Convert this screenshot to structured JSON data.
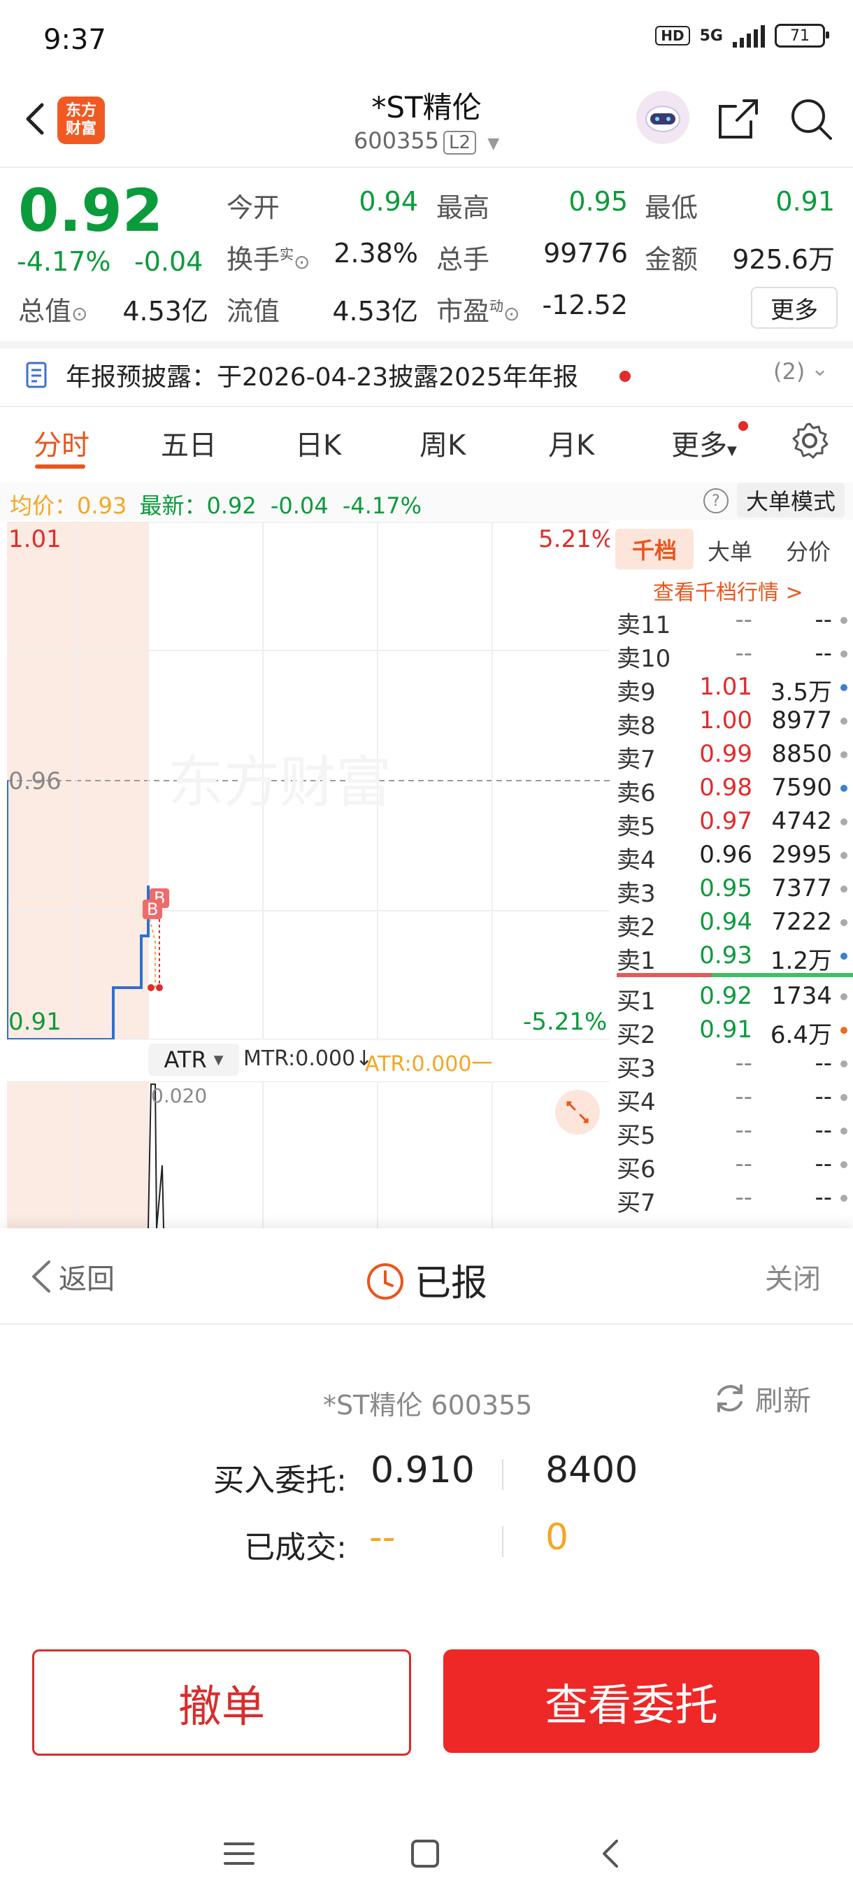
{
  "status_bar": {
    "time": "9:37",
    "hd": "HD",
    "network": "5G",
    "battery": "71"
  },
  "header": {
    "logo_line1": "东方",
    "logo_line2": "财富",
    "title": "*ST精伦",
    "code": "600355",
    "level": "L2"
  },
  "quote": {
    "price": "0.92",
    "pct": "-4.17%",
    "chg": "-0.04",
    "open_label": "今开",
    "open": "0.94",
    "high_label": "最高",
    "high": "0.95",
    "low_label": "最低",
    "low": "0.91",
    "turnover_label": "换手",
    "turnover_sup": "实",
    "turnover": "2.38%",
    "volume_label": "总手",
    "volume": "99776",
    "amount_label": "金额",
    "amount": "925.6万",
    "mktcap_label": "总值",
    "mktcap": "4.53亿",
    "float_label": "流值",
    "float": "4.53亿",
    "pe_label": "市盈",
    "pe_sup": "动",
    "pe": "-12.52",
    "more": "更多"
  },
  "notice": {
    "text": "年报预披露：于2026-04-23披露2025年年报",
    "count": "(2)"
  },
  "tabs": [
    "分时",
    "五日",
    "日K",
    "周K",
    "月K",
    "更多"
  ],
  "avg_line": {
    "avg_label": "均价：",
    "avg": "0.93",
    "latest_label": "最新：",
    "latest": "0.92",
    "chg": "-0.04",
    "pct": "-4.17%",
    "big_order_mode": "大单模式"
  },
  "chart_labels": {
    "top_left": "1.01",
    "top_right": "5.21%",
    "mid": "0.96",
    "bottom_left": "0.91",
    "bottom_right": "-5.21%",
    "watermark": "东方财富",
    "marker_b": "B"
  },
  "indicator": {
    "name": "ATR",
    "mtr": "MTR:0.000↓",
    "atr": "ATR:0.000一",
    "scale": "0.020"
  },
  "order_book": {
    "tabs": [
      "千档",
      "大单",
      "分价"
    ],
    "link": "查看千档行情 >",
    "asks": [
      {
        "name": "卖11",
        "price": "--",
        "vol": "--",
        "color": "#888888",
        "dot": "#aaaaaa"
      },
      {
        "name": "卖10",
        "price": "--",
        "vol": "--",
        "color": "#888888",
        "dot": "#aaaaaa"
      },
      {
        "name": "卖9",
        "price": "1.01",
        "vol": "3.5万",
        "color": "#e22b2b",
        "dot": "#3b7fd4"
      },
      {
        "name": "卖8",
        "price": "1.00",
        "vol": "8977",
        "color": "#e22b2b",
        "dot": "#aaaaaa"
      },
      {
        "name": "卖7",
        "price": "0.99",
        "vol": "8850",
        "color": "#e22b2b",
        "dot": "#aaaaaa"
      },
      {
        "name": "卖6",
        "price": "0.98",
        "vol": "7590",
        "color": "#e22b2b",
        "dot": "#3b7fd4"
      },
      {
        "name": "卖5",
        "price": "0.97",
        "vol": "4742",
        "color": "#e22b2b",
        "dot": "#aaaaaa"
      },
      {
        "name": "卖4",
        "price": "0.96",
        "vol": "2995",
        "color": "#222222",
        "dot": "#aaaaaa"
      },
      {
        "name": "卖3",
        "price": "0.95",
        "vol": "7377",
        "color": "#0a9b3b",
        "dot": "#aaaaaa"
      },
      {
        "name": "卖2",
        "price": "0.94",
        "vol": "7222",
        "color": "#0a9b3b",
        "dot": "#aaaaaa"
      },
      {
        "name": "卖1",
        "price": "0.93",
        "vol": "1.2万",
        "color": "#0a9b3b",
        "dot": "#3b7fd4"
      }
    ],
    "bids": [
      {
        "name": "买1",
        "price": "0.92",
        "vol": "1734",
        "color": "#0a9b3b",
        "dot": "#aaaaaa"
      },
      {
        "name": "买2",
        "price": "0.91",
        "vol": "6.4万",
        "color": "#0a9b3b",
        "dot": "#ee6a1f"
      },
      {
        "name": "买3",
        "price": "--",
        "vol": "--",
        "color": "#888888",
        "dot": "#aaaaaa"
      },
      {
        "name": "买4",
        "price": "--",
        "vol": "--",
        "color": "#888888",
        "dot": "#aaaaaa"
      },
      {
        "name": "买5",
        "price": "--",
        "vol": "--",
        "color": "#888888",
        "dot": "#aaaaaa"
      },
      {
        "name": "买6",
        "price": "--",
        "vol": "--",
        "color": "#888888",
        "dot": "#aaaaaa"
      },
      {
        "name": "买7",
        "price": "--",
        "vol": "--",
        "color": "#888888",
        "dot": "#aaaaaa"
      }
    ]
  },
  "sheet": {
    "back": "返回",
    "status": "已报",
    "close": "关闭",
    "stock": "*ST精伦 600355",
    "refresh": "刷新",
    "buy_label": "买入委托:",
    "buy_price": "0.910",
    "buy_qty": "8400",
    "filled_label": "已成交:",
    "filled_price": "--",
    "filled_qty": "0",
    "cancel": "撤单",
    "view": "查看委托"
  },
  "colors": {
    "up": "#e22b2b",
    "down": "#0a9b3b",
    "accent": "#e8561d"
  }
}
